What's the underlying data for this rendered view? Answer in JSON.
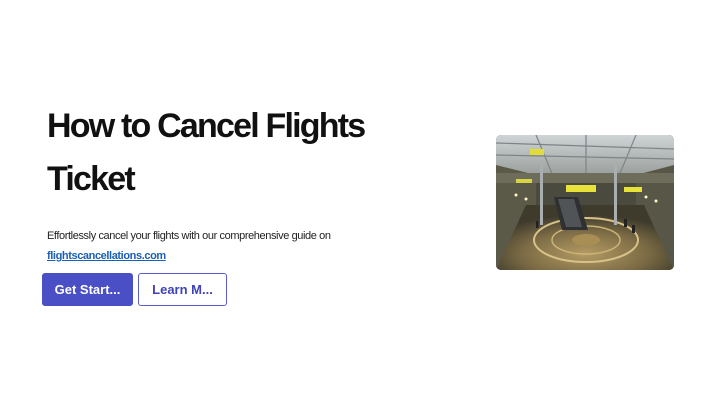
{
  "hero": {
    "title_line1": "How to Cancel Flights",
    "title_line2": "Ticket",
    "description": "Effortlessly cancel your flights with our comprehensive guide on",
    "link_text": "flightscancellations.com"
  },
  "buttons": {
    "primary_label": "Get Start...",
    "secondary_label": "Learn M..."
  },
  "image": {
    "subject": "airport terminal interior"
  },
  "colors": {
    "primary_button": "#4b4fc6",
    "secondary_border": "#5a5ec9",
    "link": "#1a5fb4",
    "title": "#111111"
  }
}
